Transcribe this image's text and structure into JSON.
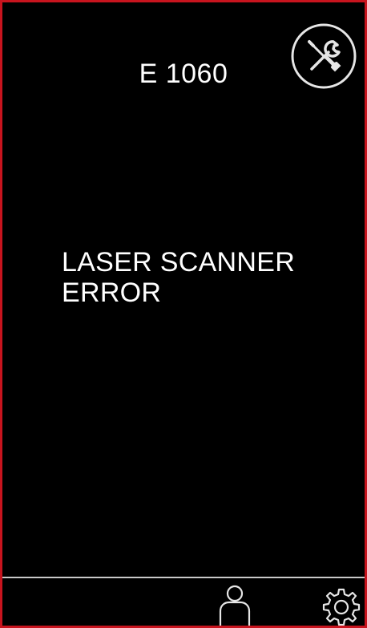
{
  "screen": {
    "error_code": "E 1060",
    "error_message_lines": [
      "LASER SCANNER",
      "ERROR"
    ]
  },
  "icons": {
    "service": "service-tools-icon",
    "user": "user-icon",
    "settings": "gear-icon"
  },
  "colors": {
    "background": "#000000",
    "border": "#c8141e",
    "text": "#ffffff",
    "icon_stroke": "#e6e6e6",
    "divider": "#c9c9c9"
  }
}
